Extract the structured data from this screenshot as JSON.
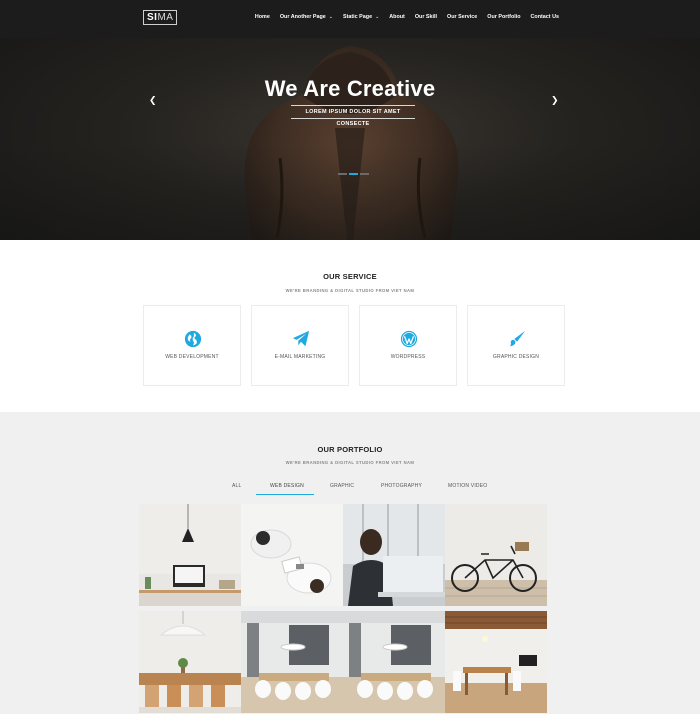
{
  "brand": {
    "logo_bold": "SI",
    "logo_light": "MA"
  },
  "nav": [
    {
      "label": "Home",
      "caret": false
    },
    {
      "label": "Our Another Page",
      "caret": true
    },
    {
      "label": "Static Page",
      "caret": true
    },
    {
      "label": "About",
      "caret": false
    },
    {
      "label": "Our Skill",
      "caret": false
    },
    {
      "label": "Our Service",
      "caret": false
    },
    {
      "label": "Our Portfolio",
      "caret": false
    },
    {
      "label": "Contact Us",
      "caret": false
    }
  ],
  "hero": {
    "title": "We Are Creative",
    "subtitle": "LOREM IPSUM DOLOR SIT AMET CONSECTE",
    "prev_icon": "chevron-left-icon",
    "next_icon": "chevron-right-icon",
    "slides": 3,
    "active_slide": 2
  },
  "service": {
    "title": "OUR SERVICE",
    "subtitle": "WE'RE BRANDING & DIGITAL STUDIO FROM VIET NAM",
    "items": [
      {
        "label": "WEB DEVELOPMENT",
        "icon": "globe-icon"
      },
      {
        "label": "E-MAIL MARKETING",
        "icon": "paper-plane-icon"
      },
      {
        "label": "WORDPRESS",
        "icon": "wordpress-icon"
      },
      {
        "label": "GRAPHIC DESIGN",
        "icon": "paint-brush-icon"
      }
    ]
  },
  "portfolio": {
    "title": "OUR PORTFOLIO",
    "subtitle": "WE'RE BRANDING & DIGITAL STUDIO FROM VIET NAM",
    "filters": [
      "ALL",
      "WEB DESIGN",
      "GRAPHIC",
      "PHOTOGRAPHY",
      "MOTION VIDEO"
    ],
    "active_filter": "WEB DESIGN",
    "images": [
      "desk-with-pendant-lamp",
      "meeting-top-view",
      "man-with-laptop",
      "bicycle-against-wall",
      "dining-room-white-lamp",
      "kitchen-white-chairs",
      "kitchen-white-chairs-2",
      "wooden-dining-room"
    ]
  },
  "colors": {
    "accent": "#1fa9e1",
    "nav_bg": "#1c1c1c",
    "portfolio_bg": "#f0f0f0"
  }
}
